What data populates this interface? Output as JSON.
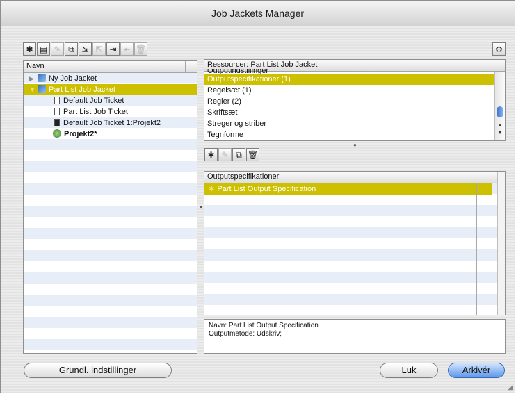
{
  "window": {
    "title": "Job Jackets Manager"
  },
  "left_toolbar": {
    "icons": [
      "new-jacket-icon",
      "new-ticket-icon",
      "edit-icon",
      "duplicate-icon",
      "import-icon",
      "export-icon",
      "link-in-icon",
      "link-out-icon",
      "trash-icon"
    ]
  },
  "tree": {
    "header": "Navn",
    "items": [
      {
        "label": "Ny Job Jacket",
        "level": 0,
        "expanded": false,
        "selected": false,
        "bold": false
      },
      {
        "label": "Part List Job Jacket",
        "level": 0,
        "expanded": true,
        "selected": true,
        "bold": false
      },
      {
        "label": "Default Job Ticket",
        "level": 1,
        "selected": false,
        "bold": false
      },
      {
        "label": "Part List Job Ticket",
        "level": 1,
        "selected": false,
        "bold": false
      },
      {
        "label": "Default Job Ticket 1:Projekt2",
        "level": 1,
        "selected": false,
        "bold": false
      },
      {
        "label": "Projekt2*",
        "level": 1,
        "selected": false,
        "bold": true
      }
    ]
  },
  "resources": {
    "header": "Ressourcer: Part List Job Jacket",
    "partial_top": "Outputindstillinger",
    "items": [
      {
        "label": "Outputspecifikationer (1)",
        "selected": true
      },
      {
        "label": "Regelsæt (1)",
        "selected": false
      },
      {
        "label": "Regler (2)",
        "selected": false
      },
      {
        "label": "Skriftsæt",
        "selected": false
      },
      {
        "label": "Streger og striber",
        "selected": false
      },
      {
        "label": "Tegnforme",
        "selected": false
      }
    ]
  },
  "detail_toolbar": {
    "icons": [
      "new-icon",
      "edit-icon",
      "duplicate-icon",
      "trash-icon"
    ]
  },
  "detail": {
    "header": "Outputspecifikationer",
    "items": [
      {
        "label": "Part List Output Specification",
        "selected": true
      }
    ]
  },
  "info": {
    "line1": "Navn: Part List Output Specification",
    "line2": "Outputmetode: Udskriv;"
  },
  "buttons": {
    "defaults": "Grundl. indstillinger",
    "close": "Luk",
    "save": "Arkivér"
  },
  "colors": {
    "selection": "#ccc000",
    "primary_button": "#5e97e8"
  }
}
